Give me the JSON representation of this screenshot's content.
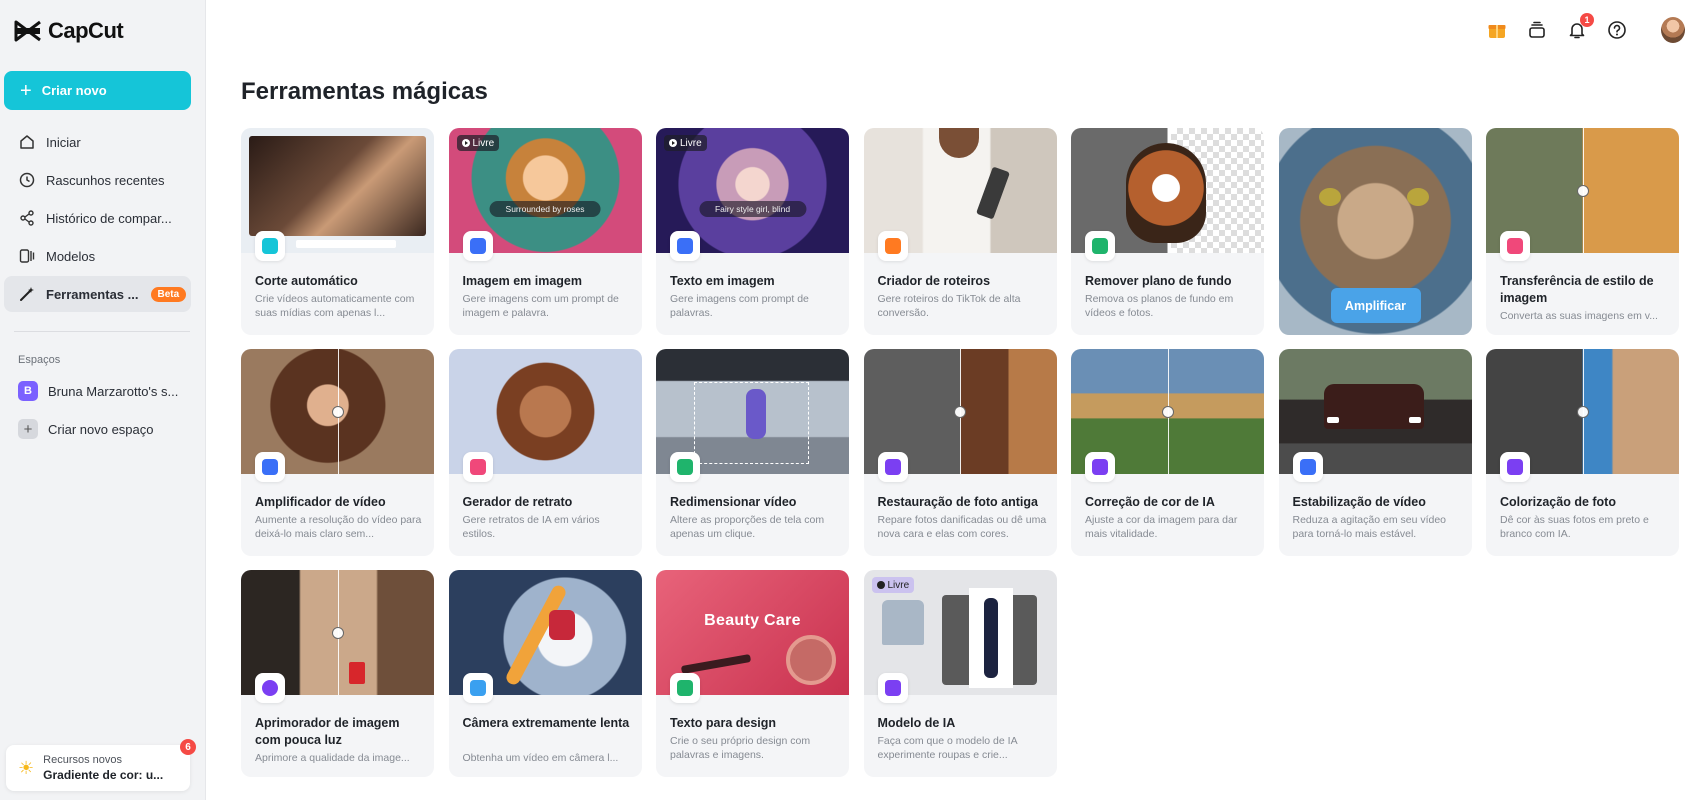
{
  "app": {
    "name": "CapCut"
  },
  "sidebar": {
    "create_label": "Criar novo",
    "nav": [
      {
        "label": "Iniciar",
        "icon": "home-icon"
      },
      {
        "label": "Rascunhos recentes",
        "icon": "clock-icon"
      },
      {
        "label": "Histórico de compar...",
        "icon": "share-icon"
      },
      {
        "label": "Modelos",
        "icon": "templates-icon"
      },
      {
        "label": "Ferramentas ...",
        "icon": "magic-wand-icon",
        "badge": "Beta",
        "active": true
      }
    ],
    "spaces_label": "Espaços",
    "spaces": [
      {
        "initial": "B",
        "label": "Bruna Marzarotto's s..."
      },
      {
        "initial": "+",
        "label": "Criar novo espaço"
      }
    ],
    "news": {
      "line1": "Recursos novos",
      "line2": "Gradiente de cor: u...",
      "count": "6"
    }
  },
  "topbar": {
    "notification_count": "1"
  },
  "main": {
    "title": "Ferramentas mágicas",
    "amplify_label": "Amplificar",
    "cards": [
      {
        "title": "Corte automático",
        "desc": "Crie vídeos automaticamente com suas mídias com apenas l...",
        "icon_color": "#15c5d8"
      },
      {
        "title": "Imagem em imagem",
        "desc": "Gere imagens com um prompt de imagem e palavra.",
        "badge": "Livre",
        "caption": "Surrounded by roses",
        "icon_color": "#3a6ff7"
      },
      {
        "title": "Texto em imagem",
        "desc": "Gere imagens com prompt de palavras.",
        "badge": "Livre",
        "caption": "Fairy style girl, blind",
        "icon_color": "#3a6ff7"
      },
      {
        "title": "Criador de roteiros",
        "desc": "Gere roteiros do TikTok de alta conversão.",
        "icon_color": "#ff7a21"
      },
      {
        "title": "Remover plano de fundo",
        "desc": "Remova os planos de fundo em vídeos e fotos.",
        "icon_color": "#1fb46c"
      },
      {
        "title": "",
        "desc": "",
        "icon_color": ""
      },
      {
        "title": "Transferência de estilo de imagem",
        "desc": "Converta as suas imagens em v...",
        "icon_color": "#f0487a"
      },
      {
        "title": "Amplificador de vídeo",
        "desc": "Aumente a resolução do vídeo para deixá-lo mais claro sem...",
        "icon_color": "#3a6ff7"
      },
      {
        "title": "Gerador de retrato",
        "desc": "Gere retratos de IA em vários estilos.",
        "icon_color": "#f0487a"
      },
      {
        "title": "Redimensionar vídeo",
        "desc": "Altere as proporções de tela com apenas um clique.",
        "icon_color": "#1fb46c"
      },
      {
        "title": "Restauração de foto antiga",
        "desc": "Repare fotos danificadas ou dê uma nova cara e elas com cores.",
        "icon_color": "#7b3ff2"
      },
      {
        "title": "Correção de cor de IA",
        "desc": "Ajuste a cor da imagem para dar mais vitalidade.",
        "icon_color": "#7b3ff2"
      },
      {
        "title": "Estabilização de vídeo",
        "desc": "Reduza a agitação em seu vídeo para torná-lo mais estável.",
        "icon_color": "#3a6ff7"
      },
      {
        "title": "Colorização de foto",
        "desc": "Dê cor às suas fotos em preto e branco com IA.",
        "icon_color": "#7b3ff2"
      },
      {
        "title": "Aprimorador de imagem com pouca luz",
        "desc": "Aprimore a qualidade da image...",
        "icon_color": "#7b3ff2"
      },
      {
        "title": "Câmera extremamente lenta",
        "desc": "Obtenha um vídeo em câmera l...",
        "icon_color": "#3aa0f0"
      },
      {
        "title": "Texto para design",
        "desc": "Crie o seu próprio design com palavras e imagens.",
        "caption_title": "Beauty Care",
        "icon_color": "#1fb46c"
      },
      {
        "title": "Modelo de IA",
        "desc": "Faça com que o modelo de IA experimente roupas e crie...",
        "badge": "Livre",
        "icon_color": "#7b3ff2"
      }
    ]
  }
}
